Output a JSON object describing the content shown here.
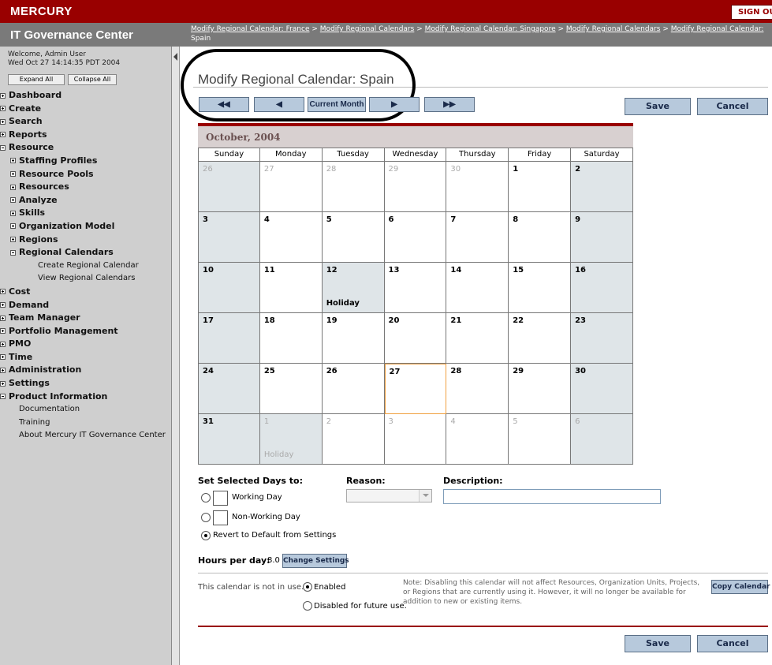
{
  "header": {
    "logo": "MERCURY",
    "sign_out": "SIGN OUT",
    "app_title": "IT Governance Center",
    "breadcrumbs": [
      "Modify Regional Calendar: France",
      "Modify Regional Calendars",
      "Modify Regional Calendar: Singapore",
      "Modify Regional Calendars",
      "Modify Regional Calendar:"
    ],
    "breadcrumb_tail": "Spain",
    "breadcrumb_sep": ">"
  },
  "sidebar": {
    "welcome_line1": "Welcome, Admin User",
    "welcome_line2": "Wed Oct 27 14:14:35 PDT 2004",
    "expand_all": "Expand All",
    "collapse_all": "Collapse All",
    "items": [
      {
        "label": "Dashboard",
        "level": 0,
        "icon": "plus"
      },
      {
        "label": "Create",
        "level": 0,
        "icon": "plus"
      },
      {
        "label": "Search",
        "level": 0,
        "icon": "plus"
      },
      {
        "label": "Reports",
        "level": 0,
        "icon": "plus"
      },
      {
        "label": "Resource",
        "level": 0,
        "icon": "minus"
      },
      {
        "label": "Staffing Profiles",
        "level": 1,
        "icon": "plus"
      },
      {
        "label": "Resource Pools",
        "level": 1,
        "icon": "plus"
      },
      {
        "label": "Resources",
        "level": 1,
        "icon": "plus"
      },
      {
        "label": "Analyze",
        "level": 1,
        "icon": "plus"
      },
      {
        "label": "Skills",
        "level": 1,
        "icon": "plus"
      },
      {
        "label": "Organization Model",
        "level": 1,
        "icon": "plus"
      },
      {
        "label": "Regions",
        "level": 1,
        "icon": "plus"
      },
      {
        "label": "Regional Calendars",
        "level": 1,
        "icon": "minus"
      },
      {
        "label": "Create Regional Calendar",
        "level": 2,
        "icon": ""
      },
      {
        "label": "View Regional Calendars",
        "level": 2,
        "icon": ""
      },
      {
        "label": "Cost",
        "level": 0,
        "icon": "plus"
      },
      {
        "label": "Demand",
        "level": 0,
        "icon": "plus"
      },
      {
        "label": "Team Manager",
        "level": 0,
        "icon": "plus"
      },
      {
        "label": "Portfolio Management",
        "level": 0,
        "icon": "plus"
      },
      {
        "label": "PMO",
        "level": 0,
        "icon": "plus"
      },
      {
        "label": "Time",
        "level": 0,
        "icon": "plus"
      },
      {
        "label": "Administration",
        "level": 0,
        "icon": "plus"
      },
      {
        "label": "Settings",
        "level": 0,
        "icon": "plus"
      },
      {
        "label": "Product Information",
        "level": 0,
        "icon": "minus"
      },
      {
        "label": "Documentation",
        "level": 3,
        "icon": ""
      },
      {
        "label": "Training",
        "level": 3,
        "icon": ""
      },
      {
        "label": "About Mercury IT Governance Center",
        "level": 3,
        "icon": ""
      }
    ]
  },
  "main": {
    "title": "Modify Regional Calendar: Spain",
    "nav": {
      "first": "◀◀",
      "prev": "◀",
      "current": "Current Month",
      "next": "▶",
      "last": "▶▶"
    },
    "save": "Save",
    "cancel": "Cancel",
    "calendar": {
      "month_label": "October, 2004",
      "days_of_week": [
        "Sunday",
        "Monday",
        "Tuesday",
        "Wednesday",
        "Thursday",
        "Friday",
        "Saturday"
      ],
      "holiday_label": "Holiday",
      "weeks": [
        [
          {
            "d": "26",
            "o": true,
            "we": true
          },
          {
            "d": "27",
            "o": true
          },
          {
            "d": "28",
            "o": true
          },
          {
            "d": "29",
            "o": true
          },
          {
            "d": "30",
            "o": true
          },
          {
            "d": "1"
          },
          {
            "d": "2",
            "we": true
          }
        ],
        [
          {
            "d": "3",
            "we": true
          },
          {
            "d": "4"
          },
          {
            "d": "5"
          },
          {
            "d": "6"
          },
          {
            "d": "7"
          },
          {
            "d": "8"
          },
          {
            "d": "9",
            "we": true
          }
        ],
        [
          {
            "d": "10",
            "we": true
          },
          {
            "d": "11"
          },
          {
            "d": "12",
            "we": true,
            "hol": true
          },
          {
            "d": "13"
          },
          {
            "d": "14"
          },
          {
            "d": "15"
          },
          {
            "d": "16",
            "we": true
          }
        ],
        [
          {
            "d": "17",
            "we": true
          },
          {
            "d": "18"
          },
          {
            "d": "19"
          },
          {
            "d": "20"
          },
          {
            "d": "21"
          },
          {
            "d": "22"
          },
          {
            "d": "23",
            "we": true
          }
        ],
        [
          {
            "d": "24",
            "we": true
          },
          {
            "d": "25"
          },
          {
            "d": "26"
          },
          {
            "d": "27",
            "today": true
          },
          {
            "d": "28"
          },
          {
            "d": "29"
          },
          {
            "d": "30",
            "we": true
          }
        ],
        [
          {
            "d": "31",
            "we": true
          },
          {
            "d": "1",
            "o": true,
            "we": true,
            "hol": true
          },
          {
            "d": "2",
            "o": true
          },
          {
            "d": "3",
            "o": true
          },
          {
            "d": "4",
            "o": true
          },
          {
            "d": "5",
            "o": true
          },
          {
            "d": "6",
            "o": true,
            "we": true
          }
        ]
      ]
    },
    "settings": {
      "set_selected_label": "Set Selected Days to:",
      "reason_label": "Reason:",
      "description_label": "Description:",
      "working_day": "Working Day",
      "non_working_day": "Non-Working Day",
      "revert": "Revert to Default from Settings",
      "reason_value": "",
      "description_value": ""
    },
    "hours": {
      "label": "Hours per day:",
      "value": "8.0",
      "change_button": "Change Settings"
    },
    "usage": {
      "status_text": "This calendar is not in use.",
      "enabled": "Enabled",
      "disabled": "Disabled for future use.",
      "note": "Note: Disabling this calendar will not affect Resources, Organization Units, Projects, or Regions that are currently using it. However, it will no longer be available for addition to new or existing items.",
      "copy_button": "Copy Calendar"
    }
  },
  "colors": {
    "brand": "#990000",
    "header_grey": "#7a7a7a",
    "button_blue": "#b7c9dc",
    "weekend": "#dfe5e8"
  }
}
